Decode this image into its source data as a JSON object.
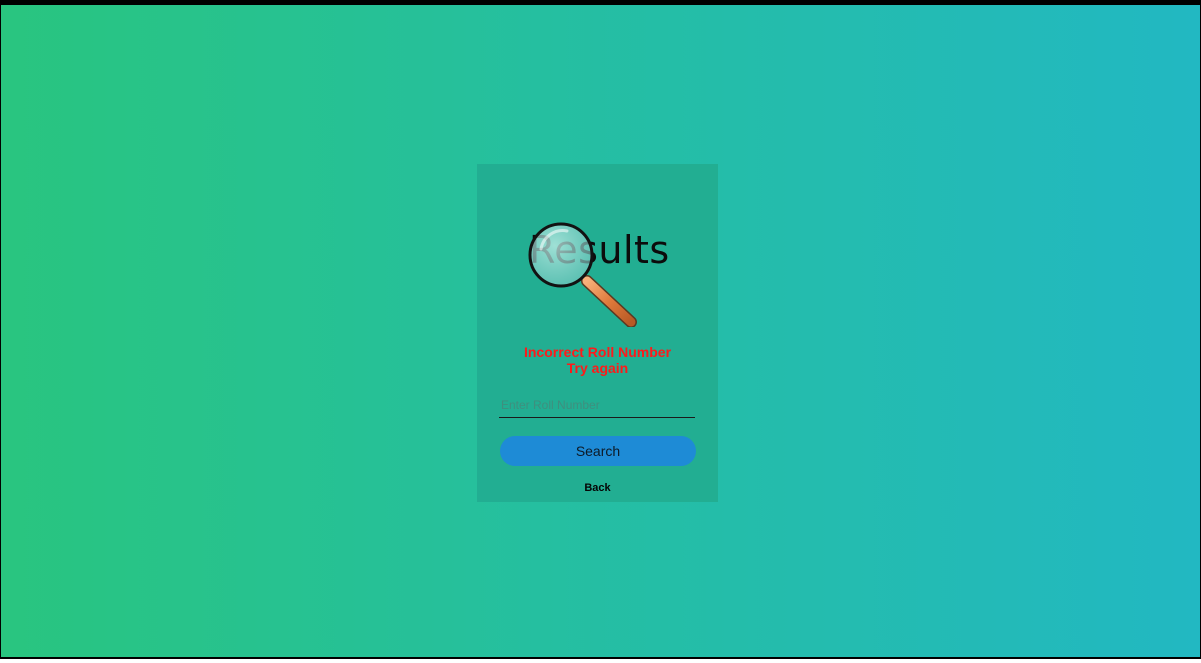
{
  "logo": {
    "text": "Results",
    "icon": "magnifying-glass-icon"
  },
  "error": {
    "line1": "Incorrect Roll Number",
    "line2": "Try again",
    "color": "#ff1a1a"
  },
  "form": {
    "roll_placeholder": "Enter Roll Number",
    "roll_value": "",
    "search_label": "Search",
    "back_label": "Back"
  },
  "colors": {
    "background_start": "#29c57f",
    "background_end": "#22b8c2",
    "card": "#22ae92",
    "button": "#1e8bd6"
  }
}
